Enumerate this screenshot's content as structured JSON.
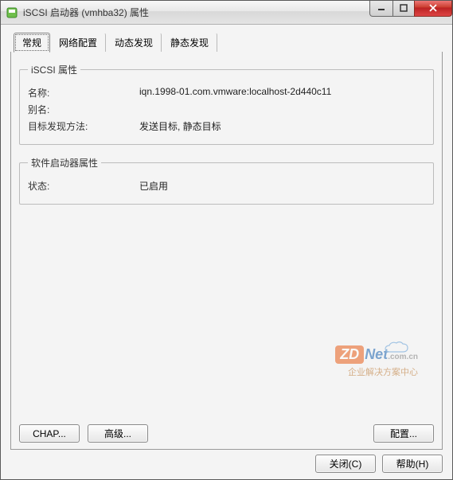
{
  "window": {
    "title": "iSCSI 启动器 (vmhba32) 属性"
  },
  "tabs": [
    {
      "label": "常规",
      "active": true
    },
    {
      "label": "网络配置",
      "active": false
    },
    {
      "label": "动态发现",
      "active": false
    },
    {
      "label": "静态发现",
      "active": false
    }
  ],
  "group_iscsi": {
    "legend": "iSCSI 属性",
    "rows": {
      "name_label": "名称:",
      "name_value": "iqn.1998-01.com.vmware:localhost-2d440c11",
      "alias_label": "别名:",
      "alias_value": "",
      "discovery_label": "目标发现方法:",
      "discovery_value": "发送目标, 静态目标"
    }
  },
  "group_software": {
    "legend": "软件启动器属性",
    "rows": {
      "status_label": "状态:",
      "status_value": "已启用"
    }
  },
  "buttons": {
    "chap": "CHAP...",
    "advanced": "高级...",
    "configure": "配置...",
    "close": "关闭(C)",
    "help": "帮助(H)"
  },
  "watermark": {
    "zd": "ZD",
    "net": "Net",
    "suffix": ".com.cn",
    "tag": "企业解决方案中心"
  }
}
